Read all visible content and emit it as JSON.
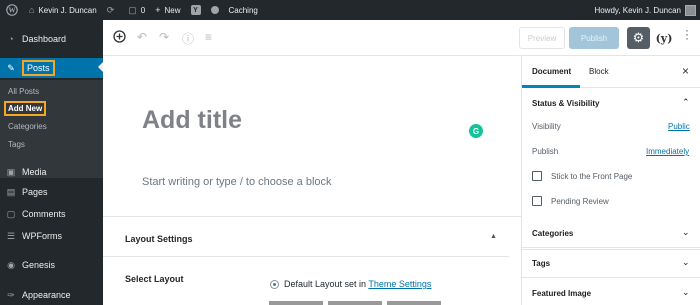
{
  "adminbar": {
    "site_name": "Kevin J. Duncan",
    "comments_count": "0",
    "new_label": "New",
    "caching_label": "Caching",
    "howdy": "Howdy, Kevin J. Duncan",
    "yoast_letter": "Y"
  },
  "sidebar": {
    "items": [
      {
        "label": "Dashboard",
        "icon": "dashboard-icon"
      },
      {
        "label": "Posts",
        "icon": "pin-icon"
      },
      {
        "label": "Media",
        "icon": "media-icon"
      },
      {
        "label": "Pages",
        "icon": "pages-icon"
      },
      {
        "label": "Comments",
        "icon": "comments-icon"
      },
      {
        "label": "WPForms",
        "icon": "forms-icon"
      },
      {
        "label": "Genesis",
        "icon": "genesis-icon"
      },
      {
        "label": "Appearance",
        "icon": "appearance-icon"
      }
    ],
    "submenu": [
      {
        "label": "All Posts"
      },
      {
        "label": "Add New"
      },
      {
        "label": "Categories"
      },
      {
        "label": "Tags"
      }
    ]
  },
  "toolbar": {
    "preview_label": "Preview",
    "publish_label": "Publish"
  },
  "editor": {
    "title_placeholder": "Add title",
    "body_placeholder": "Start writing or type / to choose a block",
    "grammarly_letter": "G"
  },
  "layout_settings": {
    "title": "Layout Settings",
    "select_label": "Select Layout",
    "default_prefix": "Default Layout set in ",
    "theme_settings_link": "Theme Settings"
  },
  "settings_panel": {
    "tab_document": "Document",
    "tab_block": "Block",
    "status_title": "Status & Visibility",
    "visibility_label": "Visibility",
    "visibility_value": "Public",
    "publish_label": "Publish",
    "publish_value": "Immediately",
    "sticky_label": "Stick to the Front Page",
    "pending_label": "Pending Review",
    "categories_title": "Categories",
    "tags_title": "Tags",
    "featured_title": "Featured Image"
  },
  "colors": {
    "admin_dark": "#23282d",
    "wp_blue": "#0073aa",
    "highlight_orange": "#f5a623",
    "grammarly_green": "#15c39a"
  }
}
